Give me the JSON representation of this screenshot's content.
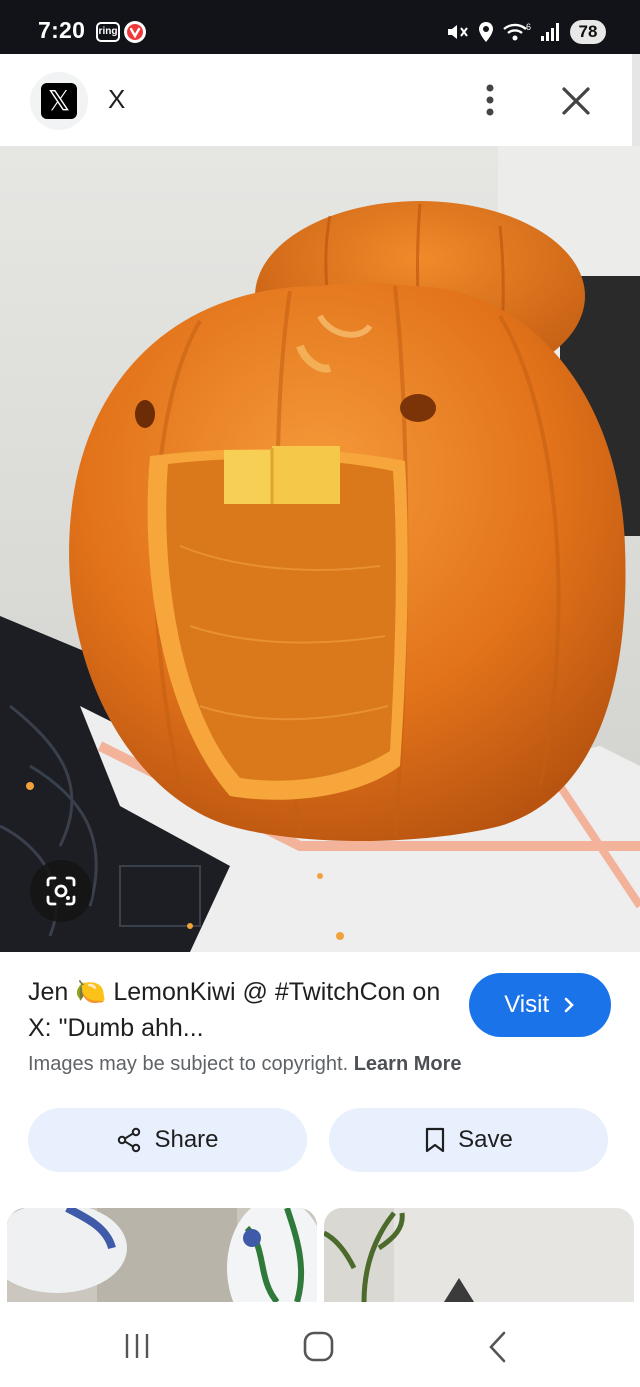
{
  "status_bar": {
    "time": "7:20",
    "ring_label": "ring",
    "battery": "78",
    "icons": [
      "ring-icon",
      "vivaldi-icon",
      "mute-vibrate-icon",
      "location-icon",
      "wifi-6-icon",
      "signal-icon"
    ]
  },
  "header": {
    "source_name": "X",
    "logo_glyph": "𝕏",
    "icons": [
      "x-logo-icon",
      "more-vert-icon",
      "close-icon"
    ]
  },
  "image": {
    "colors": {
      "pumpkin": "#e8761c",
      "pumpkin_dark": "#b9520b",
      "wall": "#dcdcd8"
    }
  },
  "result": {
    "title": "Jen 🍋 LemonKiwi @ #TwitchCon on X: \"Dumb ahh...",
    "visit_label": "Visit",
    "copyright_text": "Images may be subject to copyright.",
    "learn_more": "Learn More",
    "share_label": "Share",
    "save_label": "Save"
  },
  "colors": {
    "accent": "#1a73e8",
    "chip_bg": "#e8f0fe",
    "status_bar_bg": "#111318"
  },
  "nav": {
    "icons": [
      "recents-icon",
      "home-icon",
      "back-icon"
    ]
  }
}
